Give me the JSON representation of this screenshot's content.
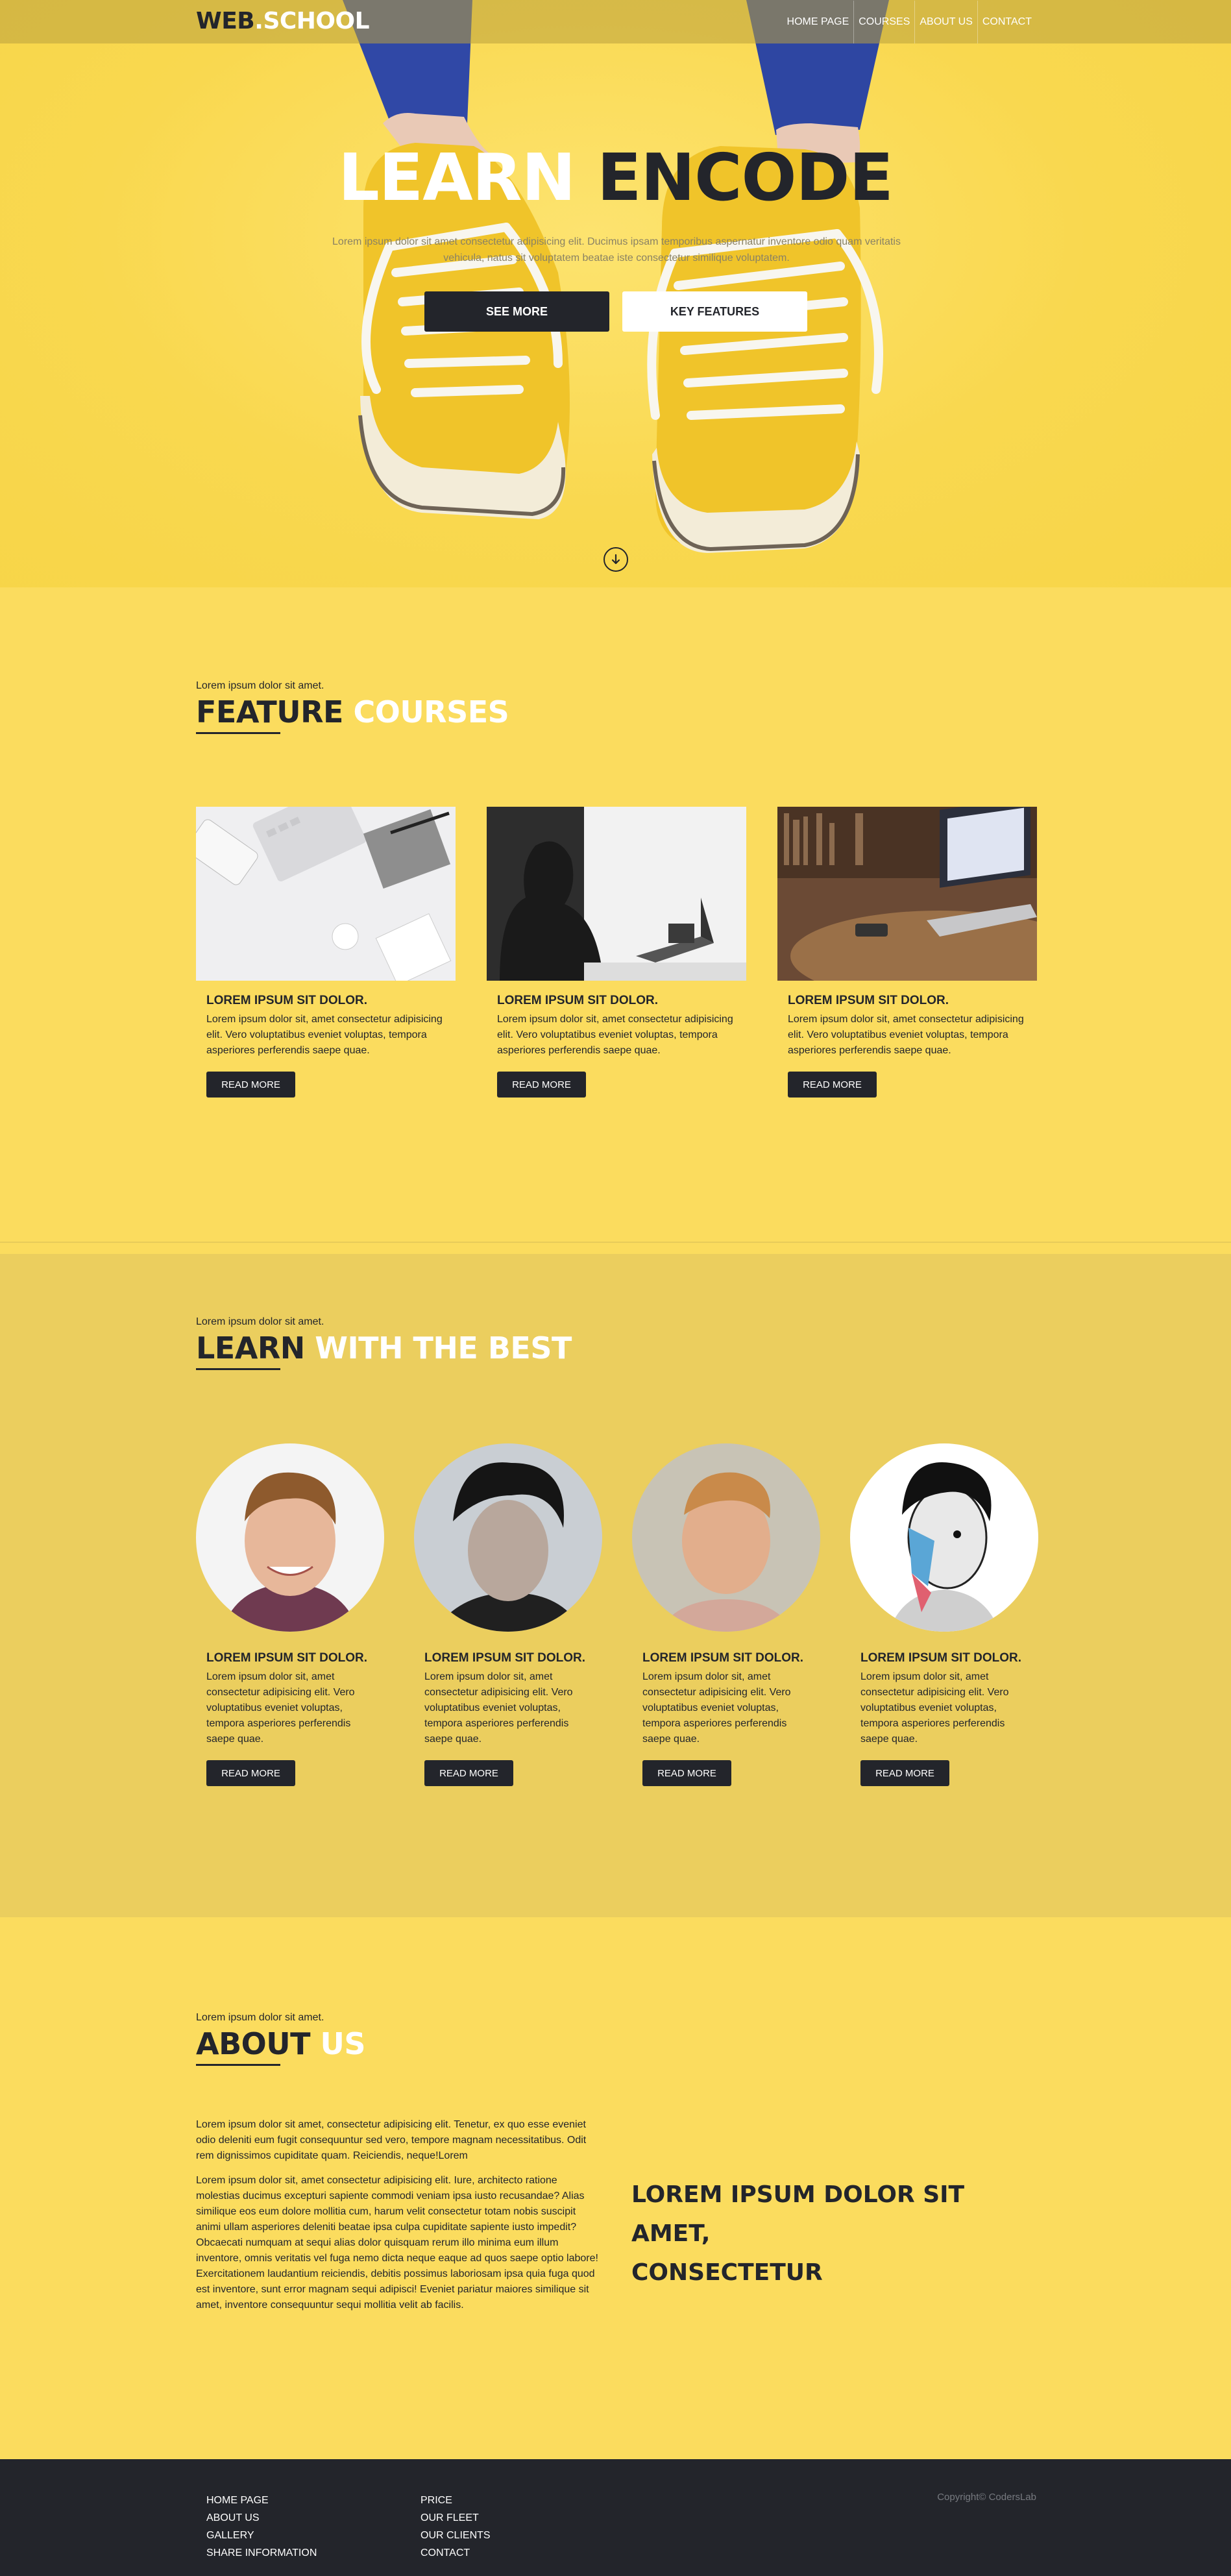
{
  "header": {
    "logo_part1": "WEB",
    "logo_dot": ".",
    "logo_part2": "SCHOOL",
    "nav": [
      "HOME PAGE",
      "COURSES",
      "ABOUT US",
      "CONTACT"
    ]
  },
  "hero": {
    "title_word1": "LEARN",
    "title_word2": "ENCODE",
    "text": "Lorem ipsum dolor sit amet consectetur adipisicing elit. Ducimus ipsam temporibus aspernatur inventore odio quam veritatis vehicula, natus sit voluptatem beatae iste consectetur similique voluptatem.",
    "btn_primary": "SEE MORE",
    "btn_secondary": "KEY FEATURES"
  },
  "courses": {
    "kicker": "Lorem ipsum dolor sit amet.",
    "title_a": "FEATURE",
    "title_b": "COURSES",
    "items": [
      {
        "title": "LOREM IPSUM SIT DOLOR.",
        "text": "Lorem ipsum dolor sit, amet consectetur adipisicing elit. Vero voluptatibus eveniet voluptas, tempora asperiores perferendis saepe quae.",
        "button": "READ MORE"
      },
      {
        "title": "LOREM IPSUM SIT DOLOR.",
        "text": "Lorem ipsum dolor sit, amet consectetur adipisicing elit. Vero voluptatibus eveniet voluptas, tempora asperiores perferendis saepe quae.",
        "button": "READ MORE"
      },
      {
        "title": "LOREM IPSUM SIT DOLOR.",
        "text": "Lorem ipsum dolor sit, amet consectetur adipisicing elit. Vero voluptatibus eveniet voluptas, tempora asperiores perferendis saepe quae.",
        "button": "READ MORE"
      }
    ]
  },
  "team": {
    "kicker": "Lorem ipsum dolor sit amet.",
    "title_a": "LEARN",
    "title_b": "WITH THE BEST",
    "items": [
      {
        "title": "LOREM IPSUM SIT DOLOR.",
        "text": "Lorem ipsum dolor sit, amet consectetur adipisicing elit. Vero voluptatibus eveniet voluptas, tempora asperiores perferendis saepe quae.",
        "button": "READ MORE"
      },
      {
        "title": "LOREM IPSUM SIT DOLOR.",
        "text": "Lorem ipsum dolor sit, amet consectetur adipisicing elit. Vero voluptatibus eveniet voluptas, tempora asperiores perferendis saepe quae.",
        "button": "READ MORE"
      },
      {
        "title": "LOREM IPSUM SIT DOLOR.",
        "text": "Lorem ipsum dolor sit, amet consectetur adipisicing elit. Vero voluptatibus eveniet voluptas, tempora asperiores perferendis saepe quae.",
        "button": "READ MORE"
      },
      {
        "title": "LOREM IPSUM SIT DOLOR.",
        "text": "Lorem ipsum dolor sit, amet consectetur adipisicing elit. Vero voluptatibus eveniet voluptas, tempora asperiores perferendis saepe quae.",
        "button": "READ MORE"
      }
    ]
  },
  "about": {
    "kicker": "Lorem ipsum dolor sit amet.",
    "title_a": "ABOUT",
    "title_b": "US",
    "para1": "Lorem ipsum dolor sit amet, consectetur adipisicing elit. Tenetur, ex quo esse eveniet odio deleniti eum fugit consequuntur sed vero, tempore magnam necessitatibus. Odit rem dignissimos cupiditate quam. Reiciendis, neque!Lorem",
    "para2": "Lorem ipsum dolor sit, amet consectetur adipisicing elit. Iure, architecto ratione molestias ducimus excepturi sapiente commodi veniam ipsa iusto recusandae? Alias similique eos eum dolore mollitia cum, harum velit consectetur totam nobis suscipit animi ullam asperiores deleniti beatae ipsa culpa cupiditate sapiente iusto impedit? Obcaecati numquam at sequi alias dolor quisquam rerum illo minima eum illum inventore, omnis veritatis vel fuga nemo dicta neque eaque ad quos saepe optio labore! Exercitationem laudantium reiciendis, debitis possimus laboriosam ipsa quia fuga quod est inventore, sunt error magnam sequi adipisci! Eveniet pariatur maiores similique sit amet, inventore consequuntur sequi mollitia velit ab facilis.",
    "big_line1": "LOREM IPSUM DOLOR SIT AMET,",
    "big_line2": "CONSECTETUR"
  },
  "footer": {
    "col1": [
      "HOME PAGE",
      "ABOUT US",
      "GALLERY",
      "SHARE INFORMATION"
    ],
    "col2": [
      "PRICE",
      "OUR FLEET",
      "OUR CLIENTS",
      "CONTACT"
    ],
    "copyright": "Copyright© CodersLab"
  },
  "colors": {
    "brand_yellow": "#fbdc5e",
    "dark": "#23252b",
    "section_alt": "#ebce5e"
  }
}
